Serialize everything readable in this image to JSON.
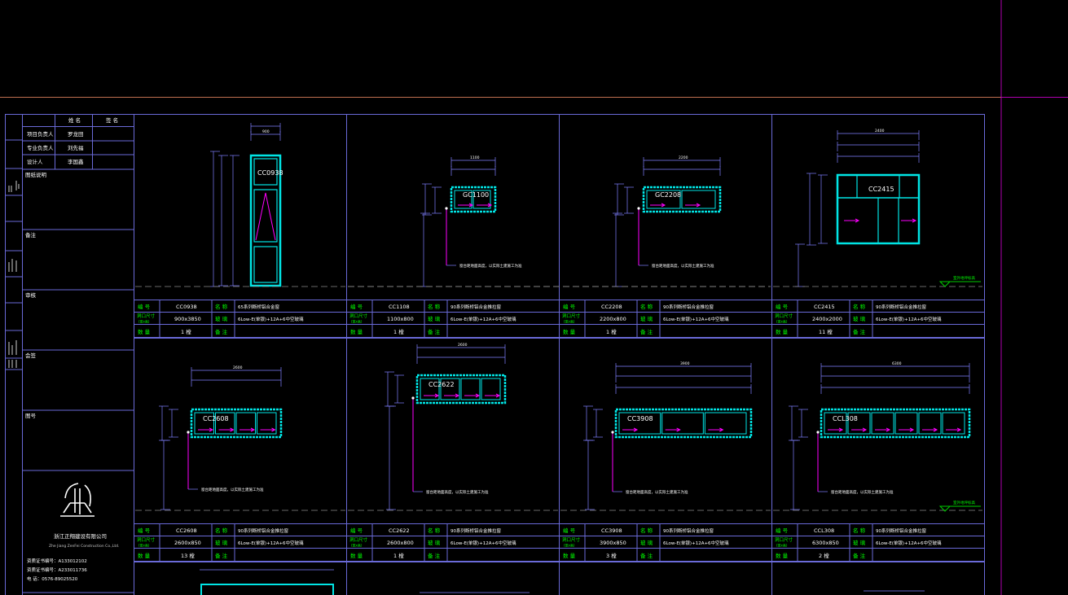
{
  "colors": {
    "background": "#000000",
    "frame": "#6a6ad8",
    "window_outline": "#00e5e5",
    "dimension": "#8080ff",
    "text": "#ffffff",
    "label": "#00ff00",
    "opening_arrow": "#ff00ff",
    "ground_marker": "#00cc00",
    "crosshair": "#b000b0",
    "border": "#c07050"
  },
  "title_block": {
    "header_cols": [
      "姓 名",
      "签 名"
    ],
    "roles": [
      {
        "role": "项目负责人",
        "name": "罗龙田"
      },
      {
        "role": "专业负责人",
        "name": "刘先福"
      },
      {
        "role": "设计人",
        "name": "李国鑫"
      }
    ],
    "sections": [
      "图纸说明",
      "备注",
      "审核",
      "会签",
      "图号"
    ],
    "company_cn": "浙江正翔建设有限公司",
    "company_en": "Zhe Jiang ZenFei Construction Co.,Ltd.",
    "cert_lines": [
      "资质证书编号：A133012102",
      "资质证书编号：A233011736",
      "电 话：0576-89025520"
    ]
  },
  "labels": {
    "id": "编 号",
    "type": "名 称",
    "size": "洞口尺寸",
    "size_sub": "(宽x高)",
    "glass": "玻 璃",
    "qty": "数 量",
    "note": "备 注",
    "ground_label": "室外地坪标高",
    "sill_note": "窗台距地面高度，以实际土建施工为准"
  },
  "windows": [
    {
      "id": "CC0938",
      "type": "65系列断桥铝合金窗",
      "size": "900x3850",
      "glass": "6Low-E(单银)+12A+6中空玻璃",
      "qty": "1",
      "qty_unit": "樘",
      "tag": "CC0938",
      "w_dim": "900"
    },
    {
      "id": "CC1108",
      "type": "90系列断桥铝合金推拉窗",
      "size": "1100x800",
      "glass": "6Low-E(单银)+12A+6中空玻璃",
      "qty": "1",
      "qty_unit": "樘",
      "tag": "GC1100",
      "w_dim": "1100"
    },
    {
      "id": "CC2208",
      "type": "90系列断桥铝合金推拉窗",
      "size": "2200x800",
      "glass": "6Low-E(单银)+12A+6中空玻璃",
      "qty": "1",
      "qty_unit": "樘",
      "tag": "GC2208",
      "w_dim": "2200"
    },
    {
      "id": "CC2415",
      "type": "90系列断桥铝合金推拉窗",
      "size": "2400x2000",
      "glass": "6Low-E(单银)+12A+6中空玻璃",
      "qty": "11",
      "qty_unit": "樘",
      "tag": "CC2415",
      "w_dim": "2400"
    },
    {
      "id": "CC2608",
      "type": "90系列断桥铝合金推拉窗",
      "size": "2600x850",
      "glass": "6Low-E(单银)+12A+6中空玻璃",
      "qty": "13",
      "qty_unit": "樘",
      "tag": "CC2608",
      "w_dim": "2600"
    },
    {
      "id": "CC2622",
      "type": "90系列断桥铝合金推拉窗",
      "size": "2600x800",
      "glass": "6Low-E(单银)+12A+6中空玻璃",
      "qty": "1",
      "qty_unit": "樘",
      "tag": "CC2622",
      "w_dim": "2600"
    },
    {
      "id": "CC3908",
      "type": "90系列断桥铝合金推拉窗",
      "size": "3900x850",
      "glass": "6Low-E(单银)+12A+6中空玻璃",
      "qty": "3",
      "qty_unit": "樘",
      "tag": "CC3908",
      "w_dim": "3900"
    },
    {
      "id": "CCL308",
      "type": "90系列断桥铝合金推拉窗",
      "size": "6300x850",
      "glass": "6Low-E(单银)+12A+6中空玻璃",
      "qty": "2",
      "qty_unit": "樘",
      "tag": "CCL308",
      "w_dim": "6300"
    }
  ]
}
